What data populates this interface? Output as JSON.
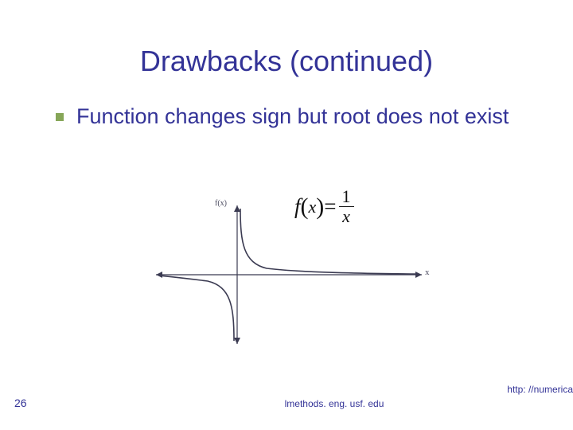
{
  "title": "Drawbacks (continued)",
  "bullet": {
    "text": "Function changes sign but root does not exist"
  },
  "figure": {
    "fx_label": "f(x)",
    "x_label": "x",
    "equation": {
      "lhs_f": "f",
      "lhs_x": "x",
      "eq": "=",
      "num": "1",
      "den": "x"
    }
  },
  "chart_data": {
    "type": "line",
    "title": "",
    "xlabel": "x",
    "ylabel": "f(x)",
    "xlim": [
      -6,
      6
    ],
    "ylim": [
      -6,
      6
    ],
    "series": [
      {
        "name": "1/x (x>0)",
        "x": [
          0.17,
          0.3,
          0.5,
          1,
          2,
          3,
          5,
          6
        ],
        "values": [
          6,
          3.33,
          2,
          1,
          0.5,
          0.33,
          0.2,
          0.17
        ]
      },
      {
        "name": "1/x (x<0)",
        "x": [
          -6,
          -5,
          -3,
          -2,
          -1,
          -0.5,
          -0.3,
          -0.17
        ],
        "values": [
          -0.17,
          -0.2,
          -0.33,
          -0.5,
          -1,
          -2,
          -3.33,
          -6
        ]
      }
    ]
  },
  "footer": {
    "page": "26",
    "center": "lmethods. eng. usf. edu",
    "right": "http: //numerica"
  }
}
